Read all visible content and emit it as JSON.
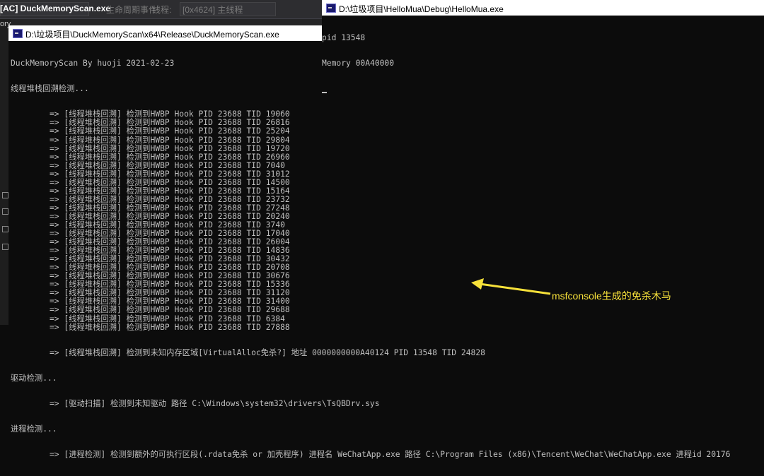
{
  "vs": {
    "process_selector": "[AC] DuckMemoryScan.exe",
    "lifecycle_label": "生命周期事件",
    "thread_label": "线程:",
    "thread_value": "[0x4624] 主线程",
    "side_text": "ory",
    "side_labels": [
      "驱动检测...",
      "进程检测..."
    ]
  },
  "console1": {
    "title": "D:\\垃圾项目\\DuckMemoryScan\\x64\\Release\\DuckMemoryScan.exe",
    "header_lines": [
      "DuckMemoryScan By huoji 2021-02-23",
      "线程堆栈回溯检测..."
    ],
    "stack_line_prefix": "=> [线程堆栈回溯] 检测到HWBP Hook PID 23688 TID ",
    "stack_tids": [
      "19060",
      "26816",
      "25204",
      "29804",
      "19720",
      "26960",
      "7040",
      "31012",
      "14500",
      "15164",
      "23732",
      "27248",
      "20240",
      "3740",
      "17040",
      "26004",
      "14836",
      "30432",
      "20708",
      "30676",
      "15336",
      "31120",
      "31400",
      "29688",
      "6384",
      "27888"
    ],
    "unknown_region_line": "=> [线程堆栈回溯] 检测到未知内存区域[VirtualAlloc免杀?] 地址 0000000000A40124 PID 13548 TID 24828",
    "driver_label": "驱动检测...",
    "driver_line": "=> [驱动扫描] 检测到未知驱动 路径 C:\\Windows\\system32\\drivers\\TsQBDrv.sys",
    "process_label": "进程检测...",
    "process_line": "=> [进程检测] 检测到额外的可执行区段(.rdata免杀 or 加壳程序) 进程名 WeChatApp.exe 路径 C:\\Program Files (x86)\\Tencent\\WeChat\\WeChatApp.exe 进程id 20176"
  },
  "console2": {
    "title": "D:\\垃圾项目\\HelloMua\\Debug\\HelloMua.exe",
    "lines": [
      "pid 13548",
      "Memory 00A40000"
    ]
  },
  "annotation": {
    "label": "msfconsole生成的免杀木马",
    "color": "#f7e13a"
  }
}
